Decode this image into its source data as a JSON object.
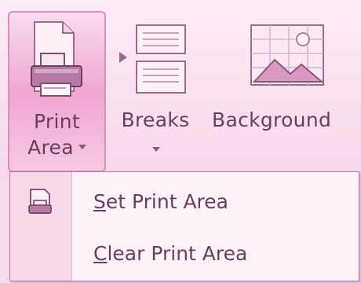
{
  "ribbon": {
    "print_area": {
      "label_line1": "Print",
      "label_line2": "Area"
    },
    "breaks": {
      "label": "Breaks"
    },
    "background": {
      "label": "Background"
    }
  },
  "menu": {
    "items": [
      {
        "mnemonic": "S",
        "rest": "et Print Area",
        "icon": "set-print-area-icon"
      },
      {
        "mnemonic": "C",
        "rest": "lear Print Area",
        "icon": ""
      }
    ]
  },
  "colors": {
    "ribbon_bg": "#f9e1ef",
    "selected_button": "#efa6cf",
    "text": "#6b3d63",
    "menu_bg": "#fdf3f9"
  },
  "icons": {
    "print_area": "printer-page-icon",
    "breaks": "page-breaks-icon",
    "background": "background-image-icon"
  }
}
